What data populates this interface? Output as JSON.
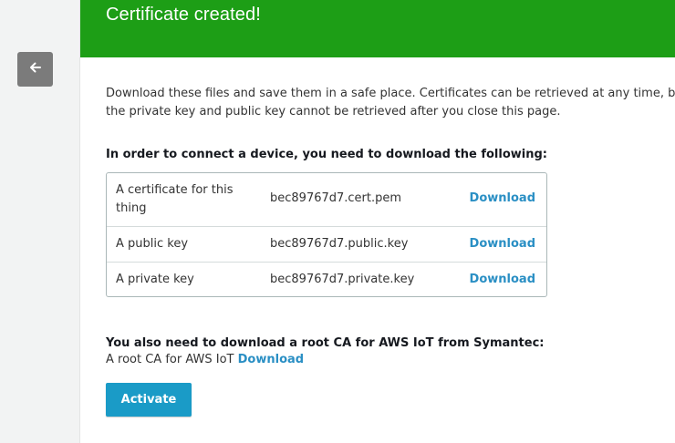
{
  "header": {
    "title": "Certificate created!"
  },
  "intro": {
    "text": "Download these files and save them in a safe place. Certificates can be retrieved at any time, but the private key and public key cannot be retrieved after you close this page."
  },
  "files_section": {
    "heading": "In order to connect a device, you need to download the following:",
    "rows": [
      {
        "description": "A certificate for this thing",
        "filename": "bec89767d7.cert.pem",
        "action": "Download"
      },
      {
        "description": "A public key",
        "filename": "bec89767d7.public.key",
        "action": "Download"
      },
      {
        "description": "A private key",
        "filename": "bec89767d7.private.key",
        "action": "Download"
      }
    ]
  },
  "root_ca": {
    "heading": "You also need to download a root CA for AWS IoT from Symantec:",
    "label": "A root CA for AWS IoT",
    "link": "Download"
  },
  "actions": {
    "activate": "Activate"
  },
  "colors": {
    "header_bg": "#1d9e16",
    "link": "#2a8fc4",
    "primary_button": "#1a9bc7"
  },
  "icons": {
    "back": "arrow-left-icon"
  }
}
